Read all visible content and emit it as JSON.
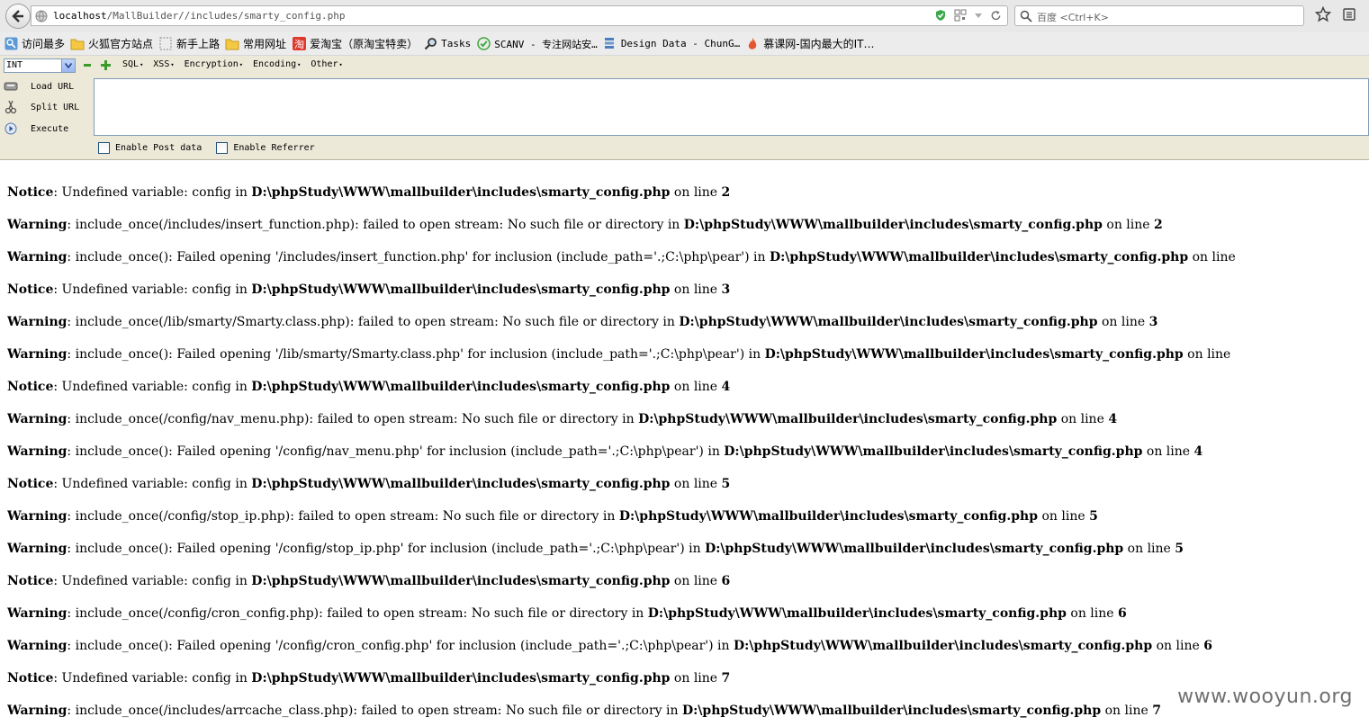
{
  "browser": {
    "url_host": "localhost",
    "url_path": "/MallBuilder//includes/smarty_config.php",
    "search_placeholder": "百度 <Ctrl+K>"
  },
  "bookmarks": [
    {
      "label": "访问最多",
      "icon": "search-icon"
    },
    {
      "label": "火狐官方站点",
      "icon": "folder-icon"
    },
    {
      "label": "新手上路",
      "icon": "folder-empty-icon"
    },
    {
      "label": "常用网址",
      "icon": "folder-icon"
    },
    {
      "label": "爱淘宝（原淘宝特卖）",
      "icon": "taobao-icon"
    },
    {
      "label": "Tasks",
      "icon": "magnifier-icon"
    },
    {
      "label": "SCANV - 专注网站安…",
      "icon": "check-circle-icon"
    },
    {
      "label": "Design Data - ChunG…",
      "icon": "database-icon"
    },
    {
      "label": "慕课网-国内最大的IT…",
      "icon": "flame-icon"
    }
  ],
  "hackbar": {
    "select_value": "INT",
    "menus": [
      "SQL",
      "XSS",
      "Encryption",
      "Encoding",
      "Other"
    ],
    "load_url": "Load URL",
    "split_url": "Split URL",
    "execute": "Execute",
    "enable_post": "Enable Post data",
    "enable_referrer": "Enable Referrer"
  },
  "messages": [
    {
      "level": "Notice",
      "text": ": Undefined variable: config in ",
      "file": "D:\\phpStudy\\WWW\\mallbuilder\\includes\\smarty_config.php",
      "suffix": " on line ",
      "line": "2"
    },
    {
      "level": "Warning",
      "text": ": include_once(/includes/insert_function.php): failed to open stream: No such file or directory in ",
      "file": "D:\\phpStudy\\WWW\\mallbuilder\\includes\\smarty_config.php",
      "suffix": " on line ",
      "line": "2"
    },
    {
      "level": "Warning",
      "text": ": include_once(): Failed opening '/includes/insert_function.php' for inclusion (include_path='.;C:\\php\\pear') in ",
      "file": "D:\\phpStudy\\WWW\\mallbuilder\\includes\\smarty_config.php",
      "suffix": " on line",
      "line": ""
    },
    {
      "level": "Notice",
      "text": ": Undefined variable: config in ",
      "file": "D:\\phpStudy\\WWW\\mallbuilder\\includes\\smarty_config.php",
      "suffix": " on line ",
      "line": "3"
    },
    {
      "level": "Warning",
      "text": ": include_once(/lib/smarty/Smarty.class.php): failed to open stream: No such file or directory in ",
      "file": "D:\\phpStudy\\WWW\\mallbuilder\\includes\\smarty_config.php",
      "suffix": " on line ",
      "line": "3"
    },
    {
      "level": "Warning",
      "text": ": include_once(): Failed opening '/lib/smarty/Smarty.class.php' for inclusion (include_path='.;C:\\php\\pear') in ",
      "file": "D:\\phpStudy\\WWW\\mallbuilder\\includes\\smarty_config.php",
      "suffix": " on line",
      "line": ""
    },
    {
      "level": "Notice",
      "text": ": Undefined variable: config in ",
      "file": "D:\\phpStudy\\WWW\\mallbuilder\\includes\\smarty_config.php",
      "suffix": " on line ",
      "line": "4"
    },
    {
      "level": "Warning",
      "text": ": include_once(/config/nav_menu.php): failed to open stream: No such file or directory in ",
      "file": "D:\\phpStudy\\WWW\\mallbuilder\\includes\\smarty_config.php",
      "suffix": " on line ",
      "line": "4"
    },
    {
      "level": "Warning",
      "text": ": include_once(): Failed opening '/config/nav_menu.php' for inclusion (include_path='.;C:\\php\\pear') in ",
      "file": "D:\\phpStudy\\WWW\\mallbuilder\\includes\\smarty_config.php",
      "suffix": " on line ",
      "line": "4"
    },
    {
      "level": "Notice",
      "text": ": Undefined variable: config in ",
      "file": "D:\\phpStudy\\WWW\\mallbuilder\\includes\\smarty_config.php",
      "suffix": " on line ",
      "line": "5"
    },
    {
      "level": "Warning",
      "text": ": include_once(/config/stop_ip.php): failed to open stream: No such file or directory in ",
      "file": "D:\\phpStudy\\WWW\\mallbuilder\\includes\\smarty_config.php",
      "suffix": " on line ",
      "line": "5"
    },
    {
      "level": "Warning",
      "text": ": include_once(): Failed opening '/config/stop_ip.php' for inclusion (include_path='.;C:\\php\\pear') in ",
      "file": "D:\\phpStudy\\WWW\\mallbuilder\\includes\\smarty_config.php",
      "suffix": " on line ",
      "line": "5"
    },
    {
      "level": "Notice",
      "text": ": Undefined variable: config in ",
      "file": "D:\\phpStudy\\WWW\\mallbuilder\\includes\\smarty_config.php",
      "suffix": " on line ",
      "line": "6"
    },
    {
      "level": "Warning",
      "text": ": include_once(/config/cron_config.php): failed to open stream: No such file or directory in ",
      "file": "D:\\phpStudy\\WWW\\mallbuilder\\includes\\smarty_config.php",
      "suffix": " on line ",
      "line": "6"
    },
    {
      "level": "Warning",
      "text": ": include_once(): Failed opening '/config/cron_config.php' for inclusion (include_path='.;C:\\php\\pear') in ",
      "file": "D:\\phpStudy\\WWW\\mallbuilder\\includes\\smarty_config.php",
      "suffix": " on line ",
      "line": "6"
    },
    {
      "level": "Notice",
      "text": ": Undefined variable: config in ",
      "file": "D:\\phpStudy\\WWW\\mallbuilder\\includes\\smarty_config.php",
      "suffix": " on line ",
      "line": "7"
    },
    {
      "level": "Warning",
      "text": ": include_once(/includes/arrcache_class.php): failed to open stream: No such file or directory in ",
      "file": "D:\\phpStudy\\WWW\\mallbuilder\\includes\\smarty_config.php",
      "suffix": " on line ",
      "line": "7"
    }
  ],
  "watermark": "www.wooyun.org"
}
